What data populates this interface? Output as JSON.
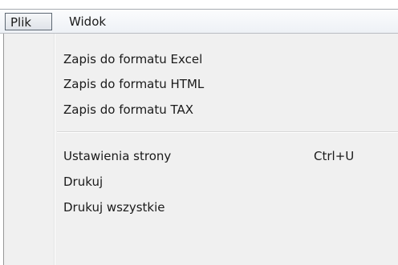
{
  "menubar": {
    "items": [
      {
        "label": "Plik"
      },
      {
        "label": "Widok"
      }
    ]
  },
  "dropdown": {
    "groups": [
      {
        "items": [
          {
            "label": "Zapis do formatu Excel",
            "shortcut": ""
          },
          {
            "label": "Zapis do formatu HTML",
            "shortcut": ""
          },
          {
            "label": "Zapis do formatu TAX",
            "shortcut": ""
          }
        ]
      },
      {
        "items": [
          {
            "label": "Ustawienia strony",
            "shortcut": "Ctrl+U"
          },
          {
            "label": "Drukuj",
            "shortcut": ""
          },
          {
            "label": "Drukuj wszystkie",
            "shortcut": ""
          }
        ]
      }
    ]
  }
}
